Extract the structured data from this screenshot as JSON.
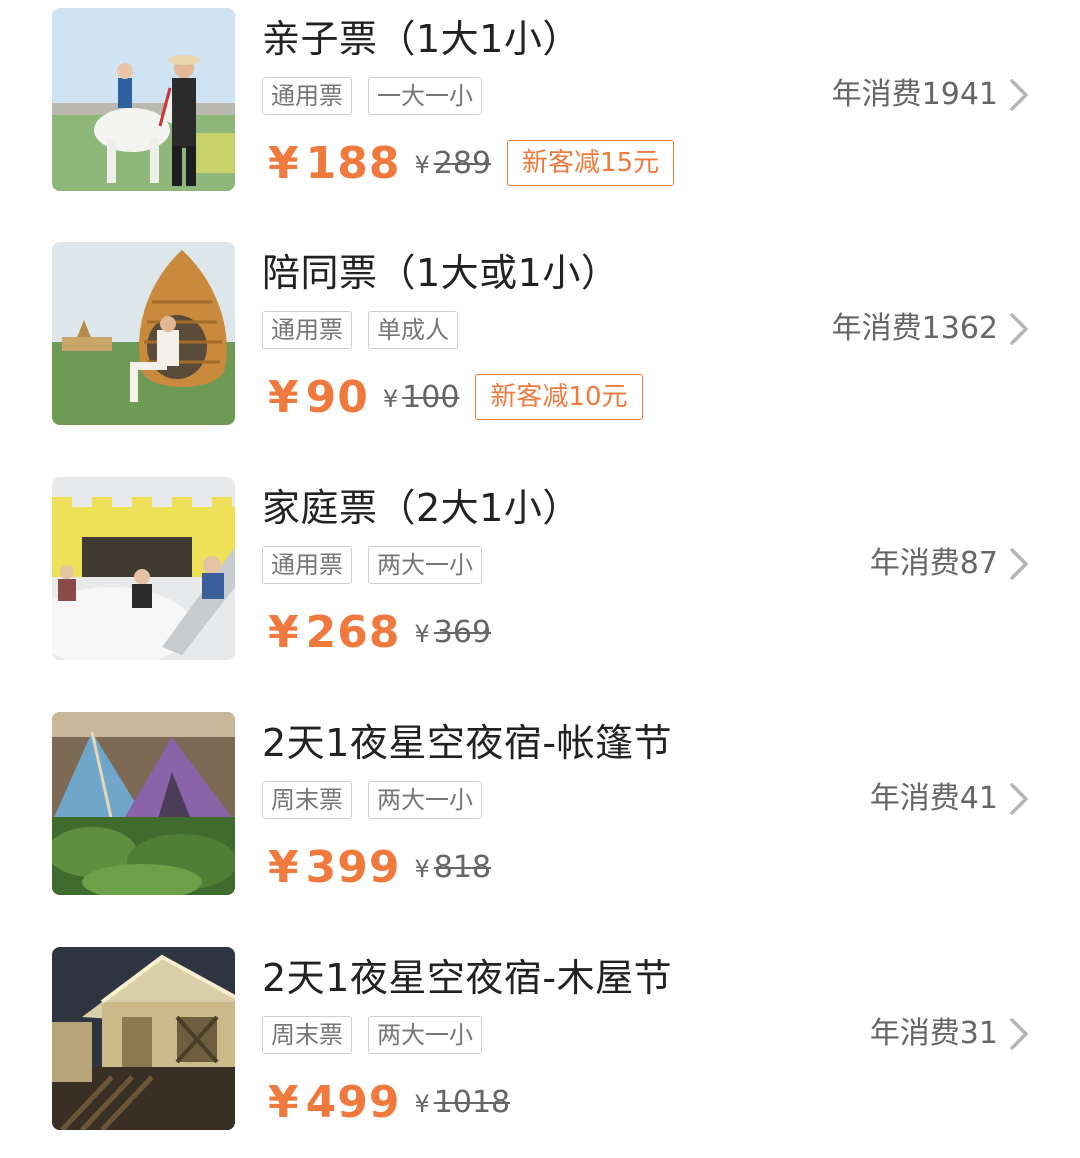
{
  "items": [
    {
      "title": "亲子票（1大1小）",
      "tags": [
        "通用票",
        "一大一小"
      ],
      "currency": "¥",
      "price": "188",
      "original_price": "289",
      "promo": "新客减15元",
      "sales": "年消费1941",
      "image": "child-riding-pony-photo"
    },
    {
      "title": "陪同票（1大或1小）",
      "tags": [
        "通用票",
        "单成人"
      ],
      "currency": "¥",
      "price": "90",
      "original_price": "100",
      "promo": "新客减10元",
      "sales": "年消费1362",
      "image": "rattan-nest-swing-photo"
    },
    {
      "title": "家庭票（2大1小）",
      "tags": [
        "通用票",
        "两大一小"
      ],
      "currency": "¥",
      "price": "268",
      "original_price": "369",
      "promo": "",
      "sales": "年消费87",
      "image": "castle-slide-photo"
    },
    {
      "title": "2天1夜星空夜宿-帐篷节",
      "tags": [
        "周末票",
        "两大一小"
      ],
      "currency": "¥",
      "price": "399",
      "original_price": "818",
      "promo": "",
      "sales": "年消费41",
      "image": "teepee-tents-photo"
    },
    {
      "title": "2天1夜星空夜宿-木屋节",
      "tags": [
        "周末票",
        "两大一小"
      ],
      "currency": "¥",
      "price": "499",
      "original_price": "1018",
      "promo": "",
      "sales": "年消费31",
      "image": "wooden-cabin-night-photo"
    }
  ],
  "colors": {
    "accent": "#f07a3d",
    "tag_border": "#cfcfcf",
    "muted_text": "#666666"
  },
  "icons": {
    "chevron": "chevron-right-icon"
  }
}
